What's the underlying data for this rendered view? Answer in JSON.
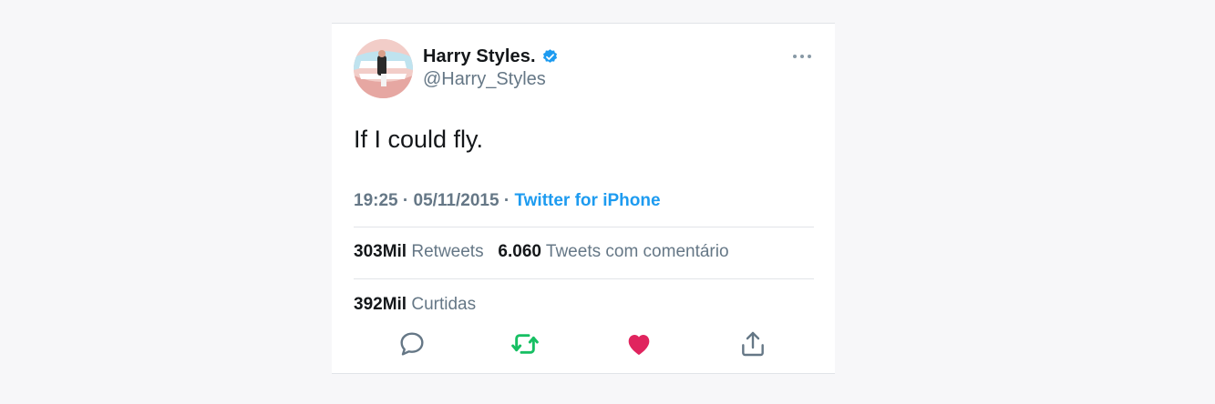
{
  "tweet": {
    "display_name": "Harry Styles.",
    "handle": "@Harry_Styles",
    "text": "If I could fly.",
    "time": "19:25",
    "date": "05/11/2015",
    "separator": "·",
    "source": "Twitter for iPhone",
    "retweets_count": "303Mil",
    "retweets_label": "Retweets",
    "quotes_count": "6.060",
    "quotes_label": "Tweets com comentário",
    "likes_count": "392Mil",
    "likes_label": "Curtidas",
    "liked": true
  },
  "icons": {
    "verified": "verified-badge-icon",
    "more": "more-options-icon",
    "reply": "reply-icon",
    "retweet": "retweet-icon",
    "like": "heart-icon",
    "share": "share-icon"
  },
  "colors": {
    "verified": "#1d9bf0",
    "link": "#1d9bf0",
    "retweet": "#17bf63",
    "like": "#e0245e",
    "muted": "#657786"
  }
}
